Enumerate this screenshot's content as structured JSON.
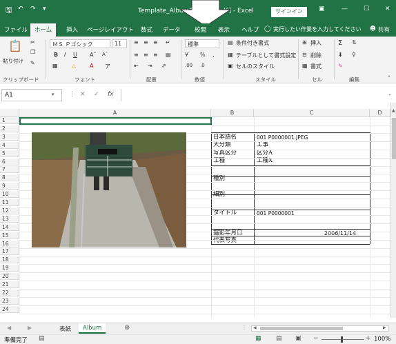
{
  "window": {
    "title": "Template_Album1 [互換モード] - Excel",
    "signin": "サインイン",
    "controls": [
      "ribbon-display",
      "minimize",
      "maximize",
      "close"
    ]
  },
  "tabs": [
    {
      "label": "ファイル"
    },
    {
      "label": "ホーム"
    },
    {
      "label": "挿入"
    },
    {
      "label": "ページレイアウト"
    },
    {
      "label": "数式"
    },
    {
      "label": "データ"
    },
    {
      "label": "校閲"
    },
    {
      "label": "表示"
    },
    {
      "label": "ヘルプ"
    },
    {
      "label": "実行したい作業を入力してください"
    },
    {
      "label": "共有"
    }
  ],
  "ribbon": {
    "paste": "貼り付け",
    "font_name": "ＭＳ Ｐゴシック",
    "font_size": "11",
    "number_format": "標準",
    "conditional": "条件付き書式",
    "as_table": "テーブルとして書式設定",
    "cell_style": "セルのスタイル",
    "insert": "挿入",
    "delete": "削除",
    "format": "書式",
    "groups": [
      "クリップボード",
      "フォント",
      "配置",
      "数値",
      "スタイル",
      "セル",
      "編集"
    ]
  },
  "formula": {
    "name_box": "A1",
    "fx": "fx",
    "value": ""
  },
  "columns": [
    "A",
    "B",
    "C",
    "D"
  ],
  "rows": [
    "1",
    "2",
    "3",
    "4",
    "5",
    "6",
    "7",
    "8",
    "9",
    "10",
    "11",
    "12",
    "13",
    "14",
    "15",
    "16",
    "17",
    "18",
    "19",
    "20",
    "21",
    "22",
    "23",
    "24"
  ],
  "table": [
    {
      "label": "日本語名",
      "value": "001 P0000001.JPEG"
    },
    {
      "label": "大分類",
      "value": "工事"
    },
    {
      "label": "写真区分",
      "value": "区分A"
    },
    {
      "label": "工種",
      "value": "工種X"
    },
    {
      "label": "種別",
      "value": ""
    },
    {
      "label": "細別",
      "value": ""
    },
    {
      "label": "タイトル",
      "value": "001 P0000001"
    },
    {
      "label": "撮影年月日",
      "value": "2006/11/14"
    },
    {
      "label": "代表写真",
      "value": ""
    }
  ],
  "sheets": [
    "表紙",
    "Album"
  ],
  "status": {
    "ready": "準備完了",
    "zoom": "100%"
  }
}
